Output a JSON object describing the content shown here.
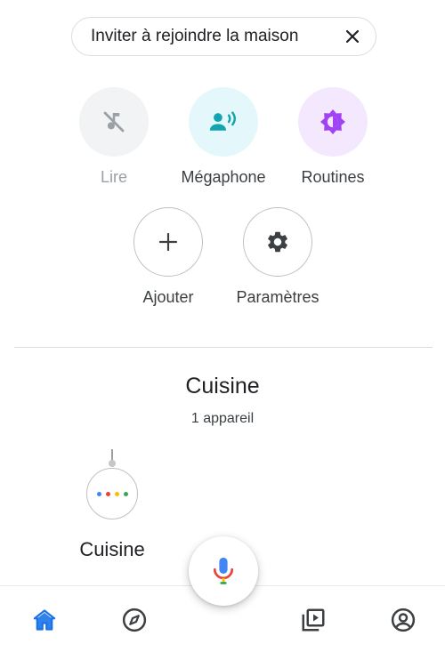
{
  "invite_chip": {
    "label": "Inviter à rejoindre la maison",
    "close_icon": "close-icon"
  },
  "actions": [
    {
      "label": "Lire",
      "icon": "music-off-icon",
      "state": "disabled",
      "bg": "#f1f3f4",
      "color": "#9aa0a6"
    },
    {
      "label": "Mégaphone",
      "icon": "broadcast-icon",
      "bg": "#e4f7fb",
      "color": "#12a4af"
    },
    {
      "label": "Routines",
      "icon": "routines-icon",
      "bg": "#f3e8fd",
      "color": "#a142f4"
    },
    {
      "label": "Ajouter",
      "icon": "plus-icon",
      "bg": "#ffffff",
      "color": "#3c4043"
    },
    {
      "label": "Paramètres",
      "icon": "gear-icon",
      "bg": "#ffffff",
      "color": "#3c4043"
    }
  ],
  "room": {
    "title": "Cuisine",
    "subtitle": "1 appareil",
    "devices": [
      {
        "name": "Cuisine",
        "icon": "google-home-mini-icon"
      }
    ]
  },
  "assistant": {
    "icon": "mic-icon"
  },
  "bottom_nav": {
    "items": [
      {
        "icon": "home-icon",
        "active": true
      },
      {
        "icon": "discover-compass-icon",
        "active": false
      },
      {
        "icon": "media-icon",
        "active": false
      },
      {
        "icon": "account-icon",
        "active": false
      }
    ]
  },
  "colors": {
    "accent_blue": "#4285f4",
    "google_red": "#ea4335",
    "google_yellow": "#fbbc04",
    "google_green": "#34a853"
  }
}
